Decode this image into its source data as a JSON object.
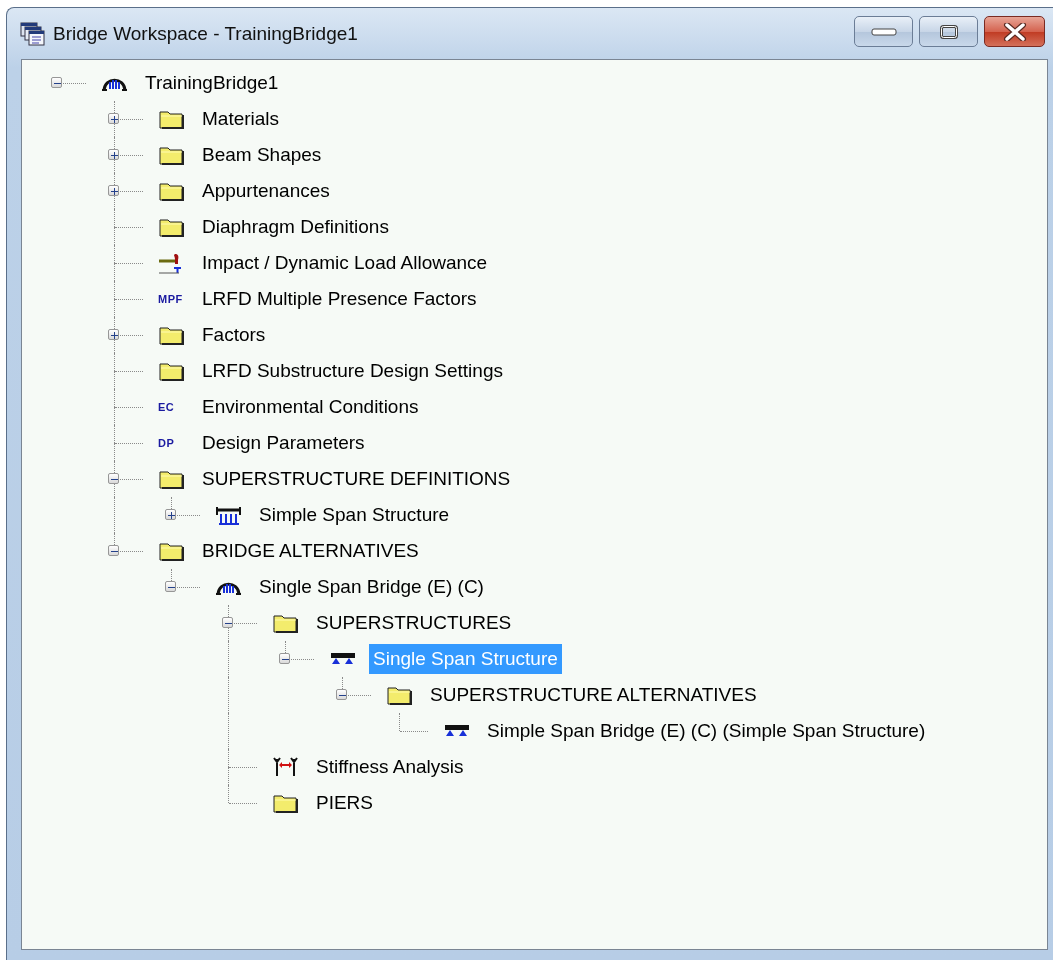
{
  "window": {
    "title": "Bridge Workspace - TrainingBridge1"
  },
  "tree": [
    {
      "label": "TrainingBridge1",
      "kind": "bridge",
      "expanded": true,
      "selected": false,
      "children": [
        {
          "label": "Materials",
          "kind": "folder",
          "expanded": false,
          "selected": false
        },
        {
          "label": "Beam Shapes",
          "kind": "folder",
          "expanded": false,
          "selected": false
        },
        {
          "label": "Appurtenances",
          "kind": "folder",
          "expanded": false,
          "selected": false
        },
        {
          "label": "Diaphragm Definitions",
          "kind": "folder",
          "selected": false
        },
        {
          "label": "Impact / Dynamic Load Allowance",
          "kind": "impact",
          "selected": false
        },
        {
          "label": "LRFD Multiple Presence Factors",
          "kind": "code",
          "code": "MPF",
          "selected": false
        },
        {
          "label": "Factors",
          "kind": "folder",
          "expanded": false,
          "selected": false
        },
        {
          "label": "LRFD Substructure Design Settings",
          "kind": "folder",
          "selected": false
        },
        {
          "label": "Environmental Conditions",
          "kind": "code",
          "code": "EC",
          "selected": false
        },
        {
          "label": "Design Parameters",
          "kind": "code",
          "code": "DP",
          "selected": false
        },
        {
          "label": "SUPERSTRUCTURE DEFINITIONS",
          "kind": "folder",
          "expanded": true,
          "selected": false,
          "children": [
            {
              "label": "Simple Span Structure",
              "kind": "girder",
              "expanded": false,
              "selected": false
            }
          ]
        },
        {
          "label": "BRIDGE ALTERNATIVES",
          "kind": "folder",
          "expanded": true,
          "selected": false,
          "children": [
            {
              "label": "Single Span Bridge (E) (C)",
              "kind": "bridge",
              "expanded": true,
              "selected": false,
              "children": [
                {
                  "label": "SUPERSTRUCTURES",
                  "kind": "folder",
                  "expanded": true,
                  "selected": false,
                  "children": [
                    {
                      "label": "Single Span Structure",
                      "kind": "structure",
                      "expanded": true,
                      "selected": true,
                      "children": [
                        {
                          "label": "SUPERSTRUCTURE ALTERNATIVES",
                          "kind": "folder",
                          "expanded": true,
                          "selected": false,
                          "children": [
                            {
                              "label": "Simple Span Bridge (E) (C) (Simple Span Structure)",
                              "kind": "structure",
                              "selected": false
                            }
                          ]
                        }
                      ]
                    }
                  ]
                },
                {
                  "label": "Stiffness Analysis",
                  "kind": "stiffness",
                  "selected": false
                },
                {
                  "label": "PIERS",
                  "kind": "folder",
                  "selected": false
                }
              ]
            }
          ]
        }
      ]
    }
  ]
}
